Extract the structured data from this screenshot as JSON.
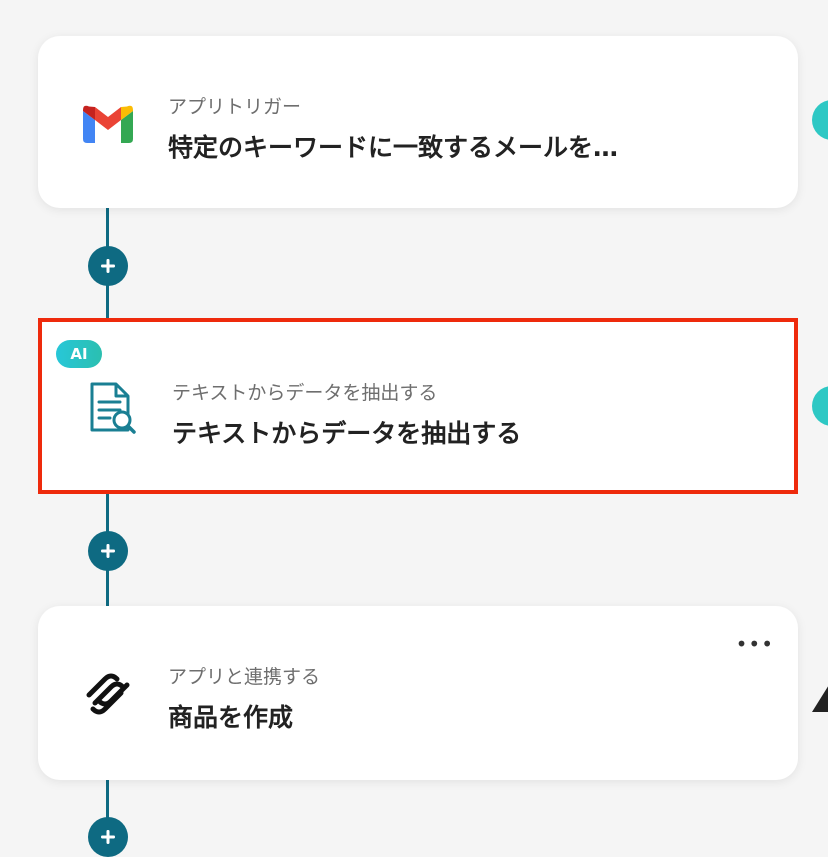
{
  "steps": [
    {
      "subtitle": "アプリトリガー",
      "title": "特定のキーワードに一致するメールを…",
      "icon": "gmail-icon"
    },
    {
      "badge": "AI",
      "subtitle": "テキストからデータを抽出する",
      "title": "テキストからデータを抽出する",
      "icon": "document-search-icon"
    },
    {
      "subtitle": "アプリと連携する",
      "title": "商品を作成",
      "icon": "squarespace-icon",
      "more": "•••"
    }
  ],
  "colors": {
    "connector": "#0e6a82",
    "selection": "#ee2a0c",
    "ai_badge": "#27c7d8",
    "side_dot": "#2ec8c4"
  }
}
